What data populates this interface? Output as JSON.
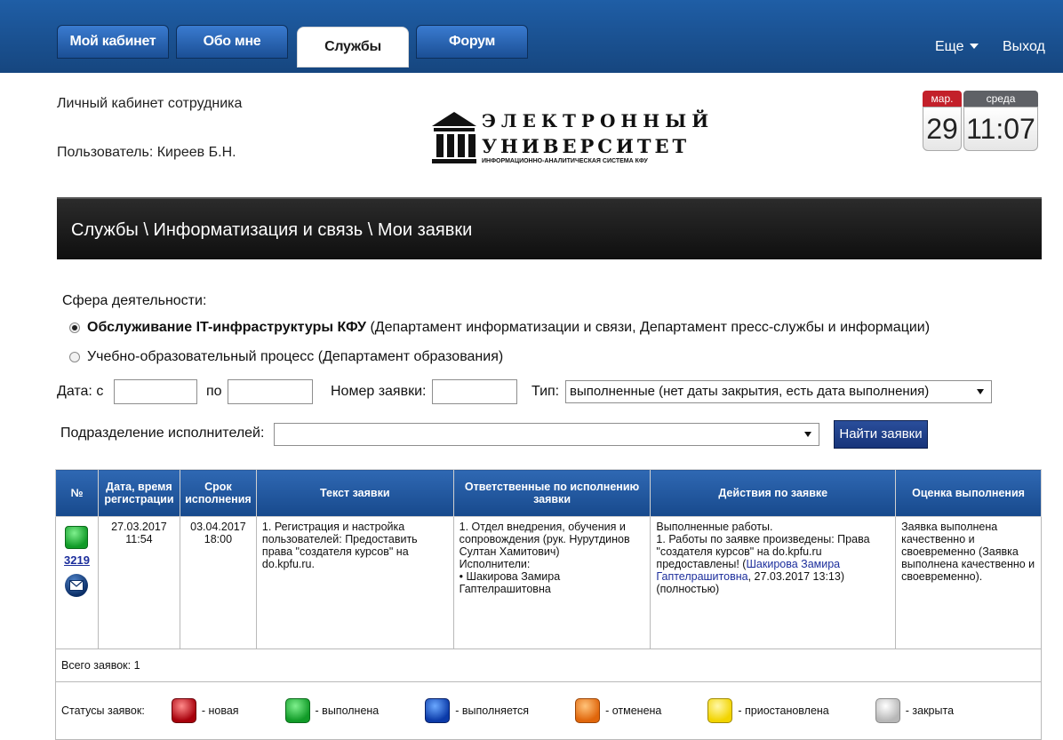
{
  "nav": {
    "tabs": [
      {
        "label": "Мой кабинет",
        "active": false
      },
      {
        "label": "Обо мне",
        "active": false
      },
      {
        "label": "Службы",
        "active": true
      },
      {
        "label": "Форум",
        "active": false
      }
    ],
    "more_label": "Еще",
    "exit_label": "Выход"
  },
  "header": {
    "title": "Личный кабинет сотрудника",
    "user": "Пользователь: Киреев Б.Н."
  },
  "logo": {
    "line1": "ЭЛЕКТРОННЫЙ",
    "line2": "УНИВЕРСИТЕТ",
    "line3": "ИНФОРМАЦИОННО-АНАЛИТИЧЕСКАЯ СИСТЕМА КФУ"
  },
  "calendar": {
    "month": "мар.",
    "weekday": "среда",
    "date": "29",
    "time": "11:07"
  },
  "breadcrumb": "Службы \\ Информатизация и связь \\ Мои заявки",
  "form": {
    "sphere_label": "Сфера деятельности:",
    "radio1_bold": "Обслуживание IT-инфраструктуры КФУ",
    "radio1_rest": " (Департамент информатизации и связи, Департамент пресс-службы и информации)",
    "radio2": "Учебно-образовательный процесс (Департамент образования)",
    "date_from_label": "Дата: с",
    "date_to_label": "по",
    "date_from": "",
    "date_to": "",
    "number_label": "Номер заявки:",
    "number_value": "",
    "type_label": "Тип:",
    "type_value": "выполненные (нет даты закрытия, есть дата выполнения)",
    "dept_label": "Подразделение исполнителей:",
    "dept_value": "",
    "find_button": "Найти заявки"
  },
  "table": {
    "headers": [
      "№",
      "Дата, время регистрации",
      "Срок исполнения",
      "Текст заявки",
      "Ответственные по исполнению заявки",
      "Действия по заявке",
      "Оценка выполнения"
    ],
    "row": {
      "number": "3219",
      "reg_date": "27.03.2017",
      "reg_time": "11:54",
      "due_date": "03.04.2017",
      "due_time": "18:00",
      "text": "1. Регистрация и настройка пользователей: Предоставить права \"создателя курсов\" на do.kpfu.ru.",
      "resp_1": "1. Отдел внедрения, обучения и сопровождения (рук. Нурутдинов Султан Хамитович)",
      "resp_2": "Исполнители:",
      "resp_3": "• Шакирова Замира Гаптелрашитовна",
      "act_1": "Выполненные работы.",
      "act_2": "1. Работы по заявке произведены: Права \"создателя курсов\" на do.kpfu.ru предоставлены! (",
      "act_link": "Шакирова Замира Гаптелрашитовна",
      "act_3": ", 27.03.2017 13:13) (полностью)",
      "rating": "Заявка выполнена качественно и своевременно (Заявка выполнена качественно и своевременно)."
    },
    "total": "Всего заявок: 1"
  },
  "legend": {
    "title": "Статусы заявок:",
    "items": [
      {
        "label": "- новая",
        "color": "#a7000b"
      },
      {
        "label": "- выполнена",
        "color": "#119b28"
      },
      {
        "label": "- выполняется",
        "color": "#0b3aa8"
      },
      {
        "label": "- отменена",
        "color": "#e0660b"
      },
      {
        "label": "- приостановлена",
        "color": "#f2d400"
      },
      {
        "label": "- закрыта",
        "color": "#b7b7b7"
      }
    ]
  }
}
